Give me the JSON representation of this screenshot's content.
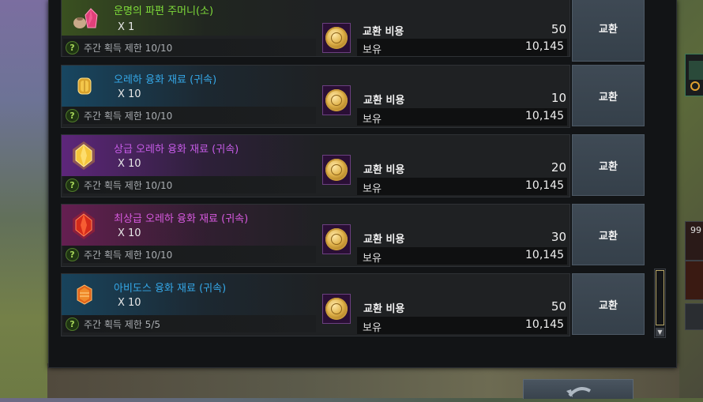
{
  "exchange_list": {
    "rows": [
      {
        "name": "운명의 파편 주머니(소)",
        "name_color": "#7fdc3a",
        "glow_color": "#3f5f1a",
        "icon": "shard-pouch-icon",
        "quantity": "X 1",
        "limit": "주간 획득 제한 10/10",
        "cost_label": "교환 비용",
        "cost": "50",
        "hold_label": "보유",
        "hold": "10,145",
        "button": "교환"
      },
      {
        "name": "오레하 융화 재료 (귀속)",
        "name_color": "#35a8e8",
        "glow_color": "#1b4f6a",
        "icon": "oreha-fusion-material-icon",
        "quantity": "X 10",
        "limit": "주간 획득 제한 10/10",
        "cost_label": "교환 비용",
        "cost": "10",
        "hold_label": "보유",
        "hold": "10,145",
        "button": "교환"
      },
      {
        "name": "상급 오레하 융화 재료 (귀속)",
        "name_color": "#c75ce8",
        "glow_color": "#5a2470",
        "icon": "superior-oreha-fusion-material-icon",
        "quantity": "X 10",
        "limit": "주간 획득 제한 10/10",
        "cost_label": "교환 비용",
        "cost": "20",
        "hold_label": "보유",
        "hold": "10,145",
        "button": "교환"
      },
      {
        "name": "최상급 오레하 융화 재료 (귀속)",
        "name_color": "#d85ae0",
        "glow_color": "#6a1f55",
        "icon": "prime-oreha-fusion-material-icon",
        "quantity": "X 10",
        "limit": "주간 획득 제한 10/10",
        "cost_label": "교환 비용",
        "cost": "30",
        "hold_label": "보유",
        "hold": "10,145",
        "button": "교환"
      },
      {
        "name": "아비도스 융화 재료 (귀속)",
        "name_color": "#35a8e8",
        "glow_color": "#1b4f6a",
        "icon": "abidos-fusion-material-icon",
        "quantity": "X 10",
        "limit": "주간 획득 제한 5/5",
        "cost_label": "교환 비용",
        "cost": "50",
        "hold_label": "보유",
        "hold": "10,145",
        "button": "교환"
      }
    ]
  },
  "side_panel": {
    "slot_count": "99"
  },
  "help_glyph": "?",
  "scroll_down_glyph": "▼"
}
